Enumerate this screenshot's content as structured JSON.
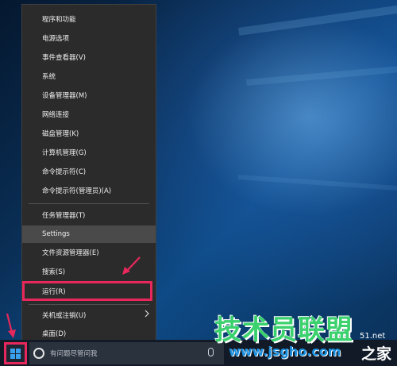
{
  "menu": {
    "items": [
      {
        "label": "程序和功能"
      },
      {
        "label": "电源选项"
      },
      {
        "label": "事件查看器(V)"
      },
      {
        "label": "系统"
      },
      {
        "label": "设备管理器(M)"
      },
      {
        "label": "网络连接"
      },
      {
        "label": "磁盘管理(K)"
      },
      {
        "label": "计算机管理(G)"
      },
      {
        "label": "命令提示符(C)"
      },
      {
        "label": "命令提示符(管理员)(A)"
      },
      {
        "label": "任务管理器(T)"
      },
      {
        "label": "Settings",
        "hovered": true
      },
      {
        "label": "文件资源管理器(E)"
      },
      {
        "label": "搜索(S)"
      },
      {
        "label": "运行(R)",
        "highlighted": true
      },
      {
        "label": "关机或注销(U)",
        "submenu_icon": "chevron-right-icon"
      },
      {
        "label": "桌面(D)"
      }
    ]
  },
  "taskbar": {
    "start_icon": "windows-logo-icon",
    "search_icon": "cortana-circle-icon",
    "search_placeholder": "有问题尽管问我",
    "mic_icon": "microphone-icon"
  },
  "watermark": {
    "brand": "技术员联盟",
    "url": "www.jsgho.com",
    "side_text": "51.net",
    "suffix": "之家"
  },
  "colors": {
    "highlight_border": "#e8285c",
    "menu_bg": "#2b2b2b",
    "taskbar_bg": "#111a26"
  }
}
